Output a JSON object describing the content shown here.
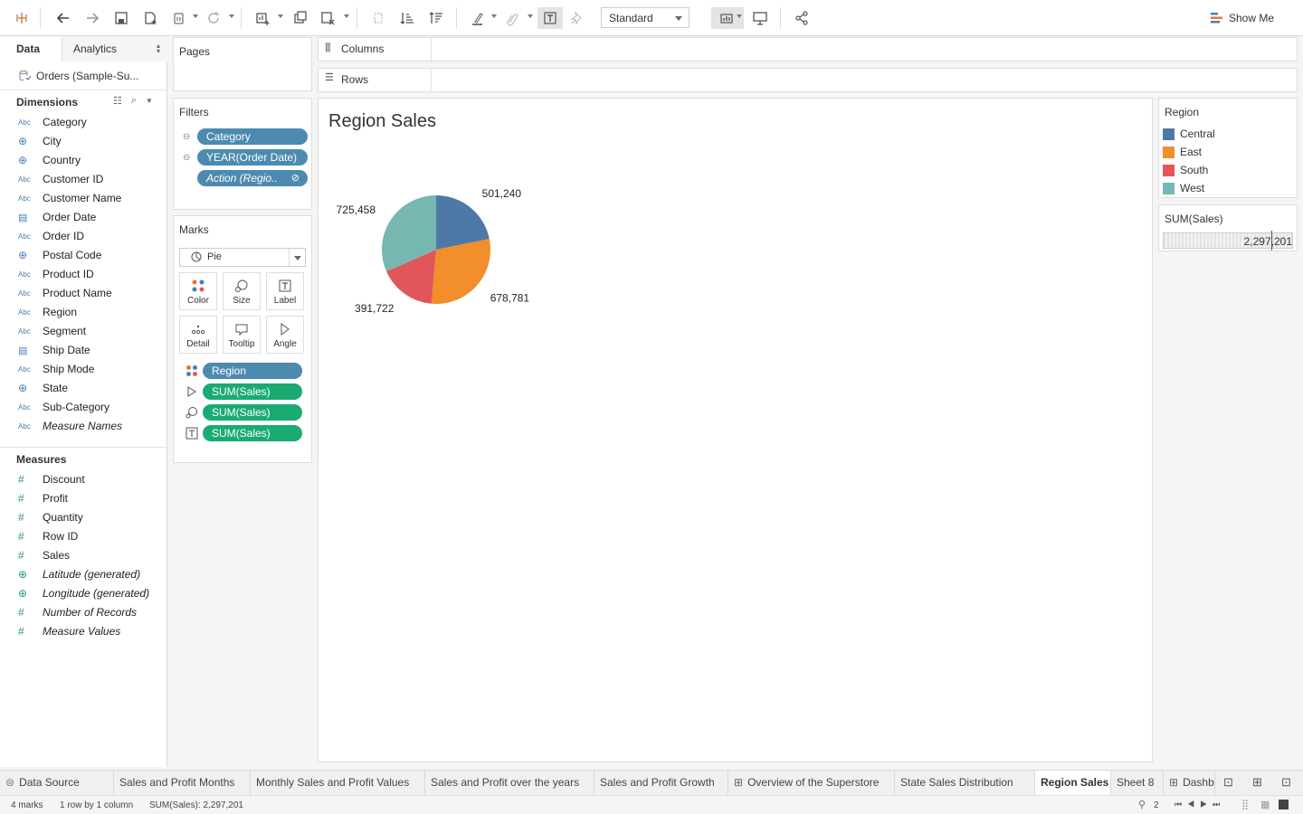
{
  "toolbar": {
    "view_mode": "Standard",
    "show_me": "Show Me"
  },
  "data_pane": {
    "tabs": [
      "Data",
      "Analytics"
    ],
    "datasource": "Orders (Sample-Su...",
    "dimensions_header": "Dimensions",
    "dimensions": [
      {
        "type": "Abc",
        "label": "Category"
      },
      {
        "type": "globe",
        "label": "City"
      },
      {
        "type": "globe",
        "label": "Country"
      },
      {
        "type": "Abc",
        "label": "Customer ID"
      },
      {
        "type": "Abc",
        "label": "Customer Name"
      },
      {
        "type": "date",
        "label": "Order Date"
      },
      {
        "type": "Abc",
        "label": "Order ID"
      },
      {
        "type": "globe",
        "label": "Postal Code"
      },
      {
        "type": "Abc",
        "label": "Product ID"
      },
      {
        "type": "Abc",
        "label": "Product Name"
      },
      {
        "type": "Abc",
        "label": "Region"
      },
      {
        "type": "Abc",
        "label": "Segment"
      },
      {
        "type": "date",
        "label": "Ship Date"
      },
      {
        "type": "Abc",
        "label": "Ship Mode"
      },
      {
        "type": "globe",
        "label": "State"
      },
      {
        "type": "Abc",
        "label": "Sub-Category"
      },
      {
        "type": "Abc",
        "label": "Measure Names",
        "italic": true
      }
    ],
    "measures_header": "Measures",
    "measures": [
      {
        "type": "hash",
        "label": "Discount"
      },
      {
        "type": "hash",
        "label": "Profit"
      },
      {
        "type": "hash",
        "label": "Quantity"
      },
      {
        "type": "hash",
        "label": "Row ID"
      },
      {
        "type": "hash",
        "label": "Sales"
      },
      {
        "type": "globe",
        "label": "Latitude (generated)",
        "italic": true
      },
      {
        "type": "globe",
        "label": "Longitude (generated)",
        "italic": true
      },
      {
        "type": "hash",
        "label": "Number of Records",
        "italic": true
      },
      {
        "type": "hash",
        "label": "Measure Values",
        "italic": true
      }
    ]
  },
  "pages": {
    "title": "Pages"
  },
  "filters": {
    "title": "Filters",
    "items": [
      "Category",
      "YEAR(Order Date)",
      "Action (Regio.."
    ]
  },
  "marks": {
    "title": "Marks",
    "type": "Pie",
    "buttons": [
      "Color",
      "Size",
      "Label",
      "Detail",
      "Tooltip",
      "Angle"
    ],
    "fields": [
      "Region",
      "SUM(Sales)",
      "SUM(Sales)",
      "SUM(Sales)"
    ]
  },
  "shelves": {
    "columns": "Columns",
    "rows": "Rows"
  },
  "view": {
    "title": "Region Sales"
  },
  "legend": {
    "title": "Region",
    "items": [
      {
        "label": "Central",
        "color": "#4e79a7"
      },
      {
        "label": "East",
        "color": "#f28e2b"
      },
      {
        "label": "South",
        "color": "#e15759"
      },
      {
        "label": "West",
        "color": "#76b7b2"
      }
    ]
  },
  "size_legend": {
    "title": "SUM(Sales)",
    "value": "2,297,201"
  },
  "chart_data": {
    "type": "pie",
    "title": "Region Sales",
    "slices": [
      {
        "label": "Central",
        "value": 501240,
        "display": "501,240",
        "color": "#4e79a7"
      },
      {
        "label": "East",
        "value": 678781,
        "display": "678,781",
        "color": "#f28e2b"
      },
      {
        "label": "South",
        "value": 391722,
        "display": "391,722",
        "color": "#e15759"
      },
      {
        "label": "West",
        "value": 725458,
        "display": "725,458",
        "color": "#76b7b2"
      }
    ]
  },
  "sheet_tabs": [
    {
      "label": "Data Source"
    },
    {
      "label": "Sales and Profit Months"
    },
    {
      "label": "Monthly Sales and Profit Values"
    },
    {
      "label": "Sales and Profit over the years"
    },
    {
      "label": "Sales and Profit Growth"
    },
    {
      "label": "Overview of the Superstore"
    },
    {
      "label": "State Sales Distribution"
    },
    {
      "label": "Region Sales",
      "active": true
    },
    {
      "label": "Sheet 8"
    },
    {
      "label": "Dashb"
    }
  ],
  "status": {
    "marks": "4 marks",
    "rows_cols": "1 row by 1 column",
    "sum": "SUM(Sales): 2,297,201",
    "user_count": "2"
  }
}
